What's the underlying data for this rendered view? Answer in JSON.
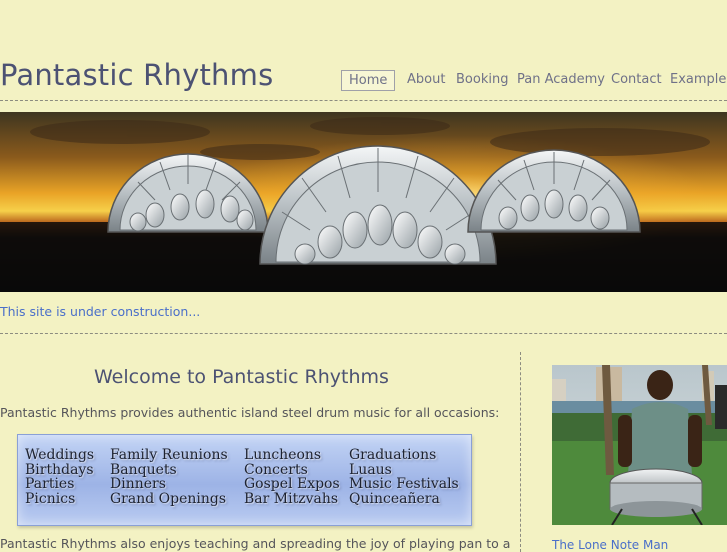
{
  "header": {
    "site_title": "Pantastic Rhythms",
    "nav": [
      {
        "label": "Home",
        "active": true
      },
      {
        "label": "About"
      },
      {
        "label": "Booking"
      },
      {
        "label": "Pan Academy"
      },
      {
        "label": "Contact"
      },
      {
        "label": "Examples"
      }
    ]
  },
  "notice": "This site is under construction...",
  "main": {
    "heading": "Welcome to Pantastic Rhythms",
    "intro": "Pantastic Rhythms provides authentic island steel drum music for all occasions:",
    "occasions": [
      [
        "Weddings",
        "Birthdays",
        "Parties",
        "Picnics"
      ],
      [
        "Family Reunions",
        "Banquets",
        "Dinners",
        "Grand Openings"
      ],
      [
        "Luncheons",
        "Concerts",
        "Gospel Expos",
        "Bar Mitzvahs"
      ],
      [
        "Graduations",
        "Luaus",
        "Music Festivals",
        "Quinceañera"
      ]
    ],
    "teaching_text": "Pantastic Rhythms also enjoys teaching and spreading the joy of playing pan to a"
  },
  "sidebar": {
    "caption": "The Lone Note Man"
  },
  "colors": {
    "background": "#f3f2c3",
    "title": "#4c5273",
    "link": "#4a6fc9",
    "occasion_panel": "#a9bdeb"
  }
}
